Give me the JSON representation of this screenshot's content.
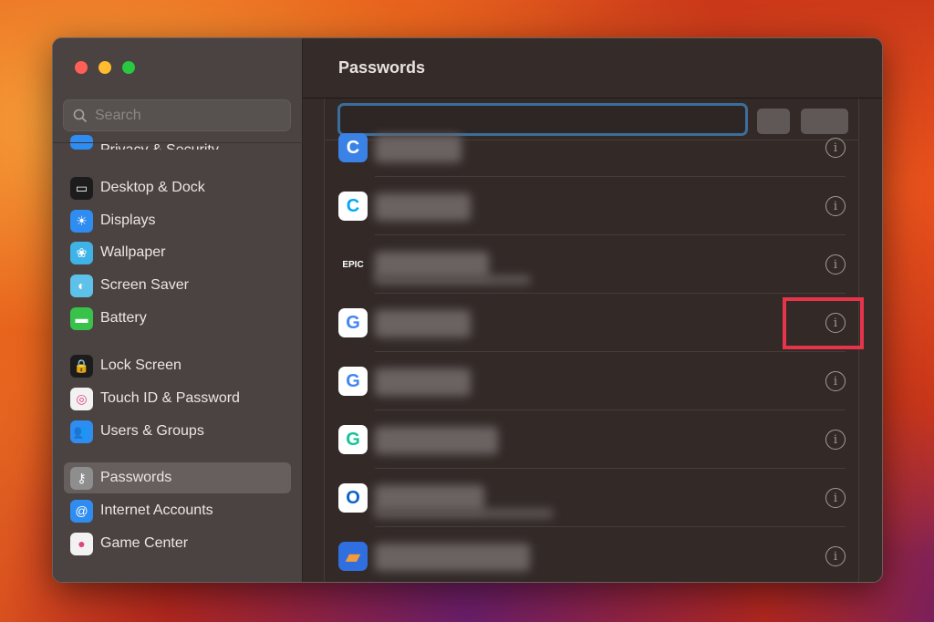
{
  "window": {
    "title": "Passwords"
  },
  "sidebar": {
    "search_placeholder": "Search",
    "partial_item": "Privacy & Security",
    "items": [
      {
        "label": "Desktop & Dock",
        "icon": "desktop-dock-icon",
        "color": "#1c1c1c",
        "glyph": "▭"
      },
      {
        "label": "Displays",
        "icon": "displays-icon",
        "color": "#2f8cf0",
        "glyph": "☀"
      },
      {
        "label": "Wallpaper",
        "icon": "wallpaper-icon",
        "color": "#3fb3e8",
        "glyph": "❀"
      },
      {
        "label": "Screen Saver",
        "icon": "screen-saver-icon",
        "color": "#5ec1ea",
        "glyph": "◐"
      },
      {
        "label": "Battery",
        "icon": "battery-icon",
        "color": "#38c24a",
        "glyph": "▬"
      },
      {
        "label": "Lock Screen",
        "icon": "lock-icon",
        "color": "#1c1c1c",
        "glyph": "🔒"
      },
      {
        "label": "Touch ID & Password",
        "icon": "fingerprint-icon",
        "color": "#f2f2f2",
        "glyph": "◎"
      },
      {
        "label": "Users & Groups",
        "icon": "users-icon",
        "color": "#2f8cf0",
        "glyph": "👥"
      },
      {
        "label": "Passwords",
        "icon": "key-icon",
        "color": "#8e8e8e",
        "glyph": "⚷",
        "selected": true
      },
      {
        "label": "Internet Accounts",
        "icon": "at-icon",
        "color": "#2f8cf0",
        "glyph": "@"
      },
      {
        "label": "Game Center",
        "icon": "game-center-icon",
        "color": "#f2f2f2",
        "glyph": "●"
      }
    ]
  },
  "passwords": [
    {
      "app": "canva-icon",
      "glyph": "C",
      "bg": "#3b82e6",
      "fg": "#ffffff"
    },
    {
      "app": "clockify-icon",
      "glyph": "C",
      "bg": "#ffffff",
      "fg": "#03a9f4"
    },
    {
      "app": "epic-games-icon",
      "glyph": "EPIC",
      "bg": "#332a28",
      "fg": "#ffffff"
    },
    {
      "app": "google-icon",
      "glyph": "G",
      "bg": "#ffffff",
      "fg": "#4285f4",
      "highlighted": true
    },
    {
      "app": "google-icon",
      "glyph": "G",
      "bg": "#ffffff",
      "fg": "#4285f4"
    },
    {
      "app": "grammarly-icon",
      "glyph": "G",
      "bg": "#ffffff",
      "fg": "#15c39a"
    },
    {
      "app": "outlook-icon",
      "glyph": "O",
      "bg": "#ffffff",
      "fg": "#0a64c8"
    },
    {
      "app": "laptop-app-icon",
      "glyph": "▰",
      "bg": "#2f6fe0",
      "fg": "#f59a3a"
    }
  ],
  "info_glyph": "i"
}
